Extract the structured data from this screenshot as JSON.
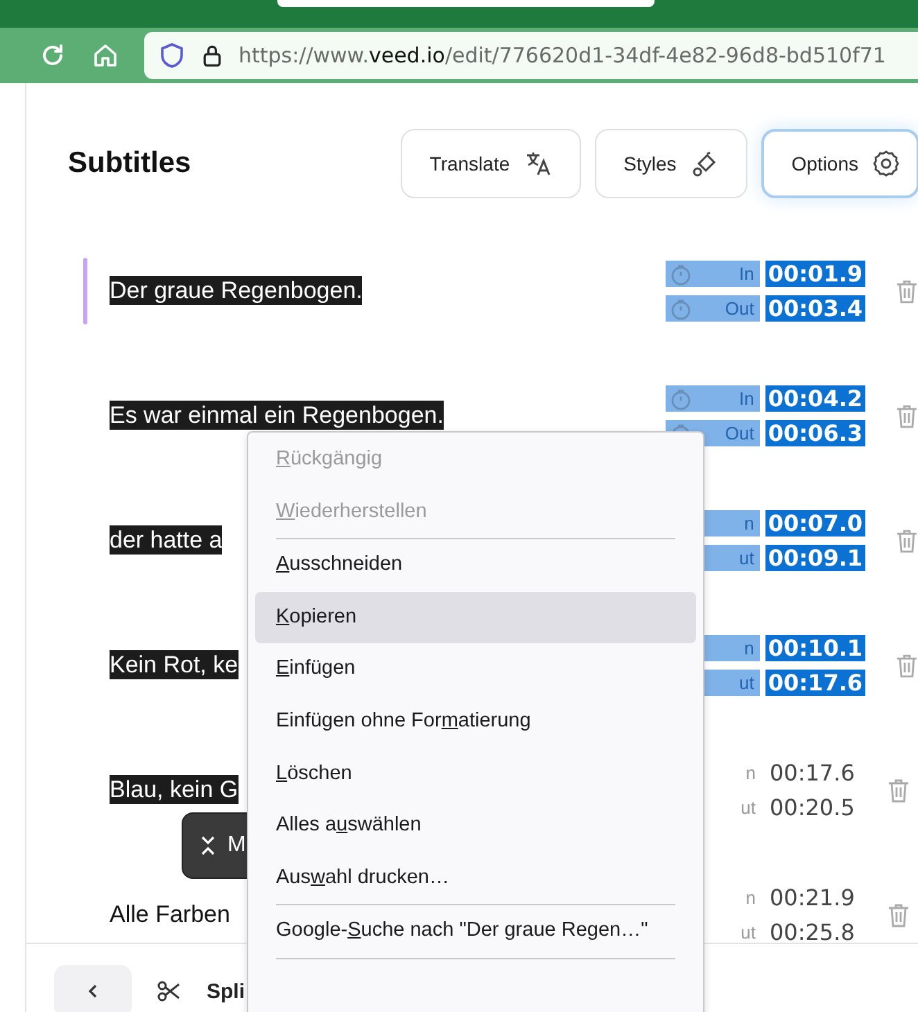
{
  "browser": {
    "url": {
      "pre": "https://www.",
      "host": "veed.io",
      "post": "/edit/776620d1-34df-4e82-96d8-bd510f71"
    }
  },
  "panel": {
    "title": "Subtitles",
    "buttons": [
      {
        "label": "Translate",
        "kind": "translate",
        "selected": false
      },
      {
        "label": "Styles",
        "kind": "styles",
        "selected": false
      },
      {
        "label": "Options",
        "kind": "options",
        "selected": true
      }
    ]
  },
  "rows": [
    {
      "text": "Der graue Regenbogen.",
      "active": true,
      "text_selected": true,
      "times_selected": true,
      "in_label": "In",
      "out_label": "Out",
      "icons": true,
      "in": "00:01.9",
      "out": "00:03.4"
    },
    {
      "text": "Es war einmal ein Regenbogen.",
      "active": false,
      "text_selected": true,
      "times_selected": true,
      "in_label": "In",
      "out_label": "Out",
      "icons": true,
      "in": "00:04.2",
      "out": "00:06.3"
    },
    {
      "text": "der hatte a",
      "active": false,
      "text_selected": true,
      "times_selected": true,
      "in_label": "n",
      "out_label": "ut",
      "icons": false,
      "in": "00:07.0",
      "out": "00:09.1"
    },
    {
      "text": "Kein Rot, ke",
      "active": false,
      "text_selected": true,
      "times_selected": true,
      "in_label": "n",
      "out_label": "ut",
      "icons": false,
      "in": "00:10.1",
      "out": "00:17.6"
    },
    {
      "text": "Blau, kein G",
      "active": false,
      "text_selected": true,
      "times_selected": false,
      "in_label": "n",
      "out_label": "ut",
      "icons": false,
      "in": "00:17.6",
      "out": "00:20.5"
    },
    {
      "text": "Alle Farben",
      "active": false,
      "text_selected": false,
      "times_selected": false,
      "in_label": "n",
      "out_label": "ut",
      "icons": false,
      "in": "00:21.9",
      "out": "00:25.8"
    }
  ],
  "merge_button": {
    "label": "M"
  },
  "toolbar": {
    "split_label": "Spli"
  },
  "context_menu": {
    "items": [
      {
        "kind": "item",
        "key": "R",
        "post": "ückgängig",
        "disabled": true,
        "selected": false
      },
      {
        "kind": "item",
        "key": "W",
        "post": "iederherstellen",
        "disabled": true,
        "selected": false
      },
      {
        "kind": "separator"
      },
      {
        "kind": "item",
        "key": "A",
        "post": "usschneiden",
        "disabled": false,
        "selected": false
      },
      {
        "kind": "item",
        "key": "K",
        "post": "opieren",
        "disabled": false,
        "selected": true
      },
      {
        "kind": "item",
        "key": "E",
        "post": "infügen",
        "disabled": false,
        "selected": false
      },
      {
        "kind": "item",
        "pre": "Einfügen ohne For",
        "key": "m",
        "post": "atierung",
        "disabled": false,
        "selected": false
      },
      {
        "kind": "item",
        "key": "L",
        "post": "öschen",
        "disabled": false,
        "selected": false
      },
      {
        "kind": "item",
        "pre": "Alles a",
        "key": "u",
        "post": "swählen",
        "disabled": false,
        "selected": false
      },
      {
        "kind": "item",
        "pre": "Aus",
        "key": "w",
        "post": "ahl drucken…",
        "disabled": false,
        "selected": false
      },
      {
        "kind": "separator"
      },
      {
        "kind": "item",
        "pre": "Google-",
        "key": "S",
        "post": "uche nach \"Der graue Regen…\"",
        "disabled": false,
        "selected": false
      },
      {
        "kind": "separator"
      }
    ]
  }
}
